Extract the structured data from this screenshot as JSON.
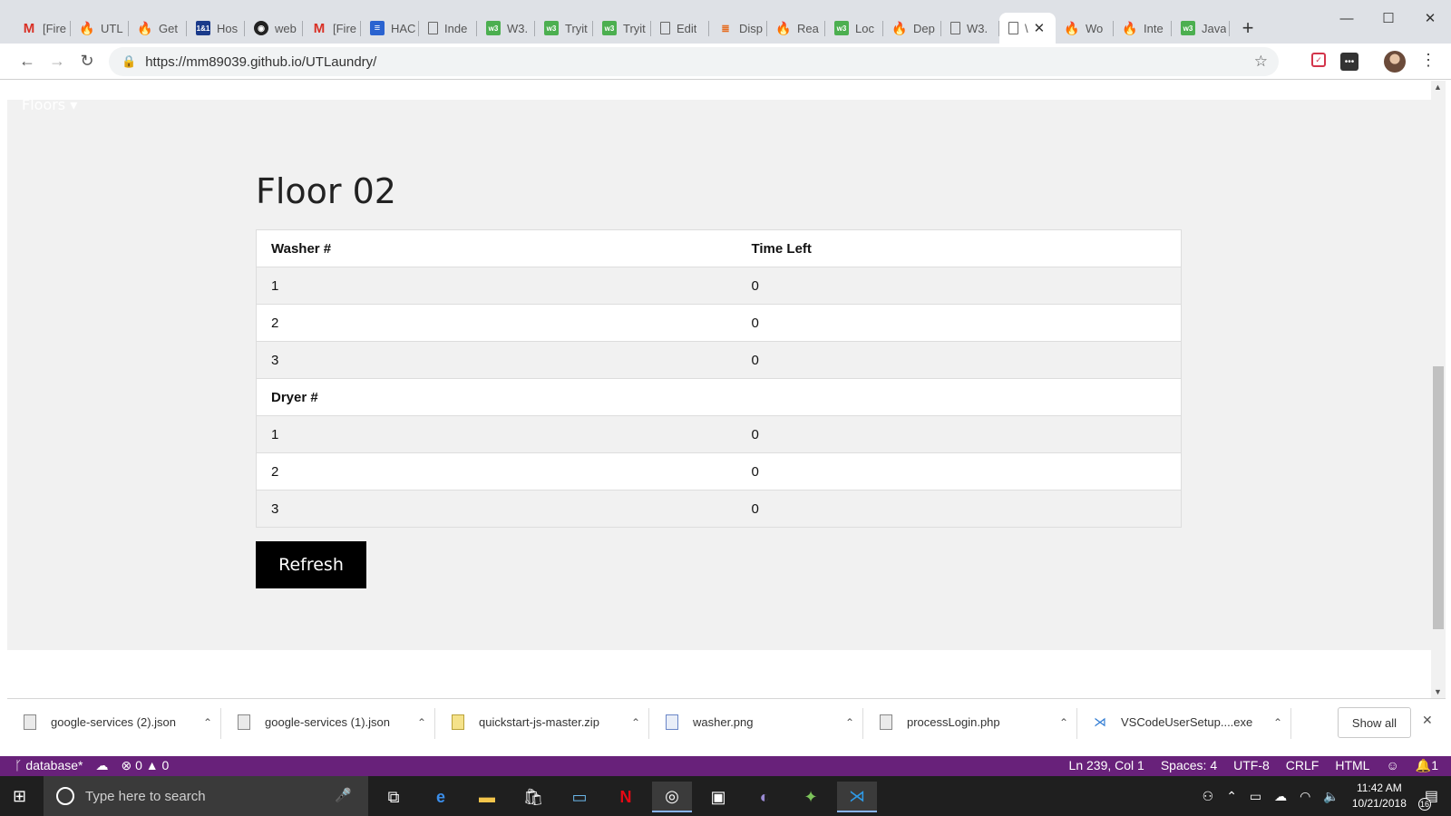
{
  "browser": {
    "tabs": [
      {
        "title": "[Fire",
        "icon": "gmail-icon",
        "glyph": "M",
        "cls": "ico-gmail"
      },
      {
        "title": "UTL",
        "icon": "firebase-icon",
        "glyph": "🔥",
        "cls": "ico-fire"
      },
      {
        "title": "Get",
        "icon": "firebase-icon",
        "glyph": "🔥",
        "cls": "ico-fire"
      },
      {
        "title": "Hos",
        "icon": "host-icon",
        "glyph": "1&1",
        "cls": "ico-hos"
      },
      {
        "title": "web",
        "icon": "github-icon",
        "glyph": "◉",
        "cls": "ico-gh"
      },
      {
        "title": "[Fire",
        "icon": "gmail-icon",
        "glyph": "M",
        "cls": "ico-gmail"
      },
      {
        "title": "HAC",
        "icon": "docs-icon",
        "glyph": "≡",
        "cls": "ico-hac"
      },
      {
        "title": "Inde",
        "icon": "page-icon",
        "glyph": "",
        "cls": "ico-doc"
      },
      {
        "title": "W3.",
        "icon": "w3schools-icon",
        "glyph": "w3",
        "cls": "ico-w3"
      },
      {
        "title": "Tryit",
        "icon": "w3schools-icon",
        "glyph": "w3",
        "cls": "ico-w3"
      },
      {
        "title": "Tryit",
        "icon": "w3schools-icon",
        "glyph": "w3",
        "cls": "ico-w3"
      },
      {
        "title": "Edit",
        "icon": "page-icon",
        "glyph": "",
        "cls": "ico-doc"
      },
      {
        "title": "Disp",
        "icon": "stackoverflow-icon",
        "glyph": "≣",
        "cls": "ico-disp"
      },
      {
        "title": "Rea",
        "icon": "firebase-icon",
        "glyph": "🔥",
        "cls": "ico-fire"
      },
      {
        "title": "Loc",
        "icon": "w3schools-icon",
        "glyph": "w3",
        "cls": "ico-w3"
      },
      {
        "title": "Dep",
        "icon": "firebase-icon",
        "glyph": "🔥",
        "cls": "ico-fire"
      },
      {
        "title": "W3.",
        "icon": "page-icon",
        "glyph": "",
        "cls": "ico-doc"
      },
      {
        "title": "\\",
        "icon": "page-icon",
        "glyph": "",
        "cls": "ico-doc",
        "active": true
      },
      {
        "title": "Wo",
        "icon": "firebase-icon",
        "glyph": "🔥",
        "cls": "ico-fire"
      },
      {
        "title": "Inte",
        "icon": "firebase-icon",
        "glyph": "🔥",
        "cls": "ico-fire"
      },
      {
        "title": "Java",
        "icon": "w3schools-icon",
        "glyph": "w3",
        "cls": "ico-w3"
      }
    ],
    "url": "https://mm89039.github.io/UTLaundry/"
  },
  "page": {
    "nav_floors": "Floors ▾",
    "title": "Floor 02",
    "washer_header": "Washer #",
    "time_header": "Time Left",
    "washers": [
      {
        "num": "1",
        "time": "0"
      },
      {
        "num": "2",
        "time": "0"
      },
      {
        "num": "3",
        "time": "0"
      }
    ],
    "dryer_header": "Dryer #",
    "dryers": [
      {
        "num": "1",
        "time": "0"
      },
      {
        "num": "2",
        "time": "0"
      },
      {
        "num": "3",
        "time": "0"
      }
    ],
    "refresh_label": "Refresh"
  },
  "downloads": {
    "items": [
      {
        "name": "google-services (2).json",
        "type": "json"
      },
      {
        "name": "google-services (1).json",
        "type": "json"
      },
      {
        "name": "quickstart-js-master.zip",
        "type": "zip"
      },
      {
        "name": "washer.png",
        "type": "png"
      },
      {
        "name": "processLogin.php",
        "type": "php"
      },
      {
        "name": "VSCodeUserSetup....exe",
        "type": "exe"
      }
    ],
    "show_all": "Show all"
  },
  "statusbar": {
    "branch": "database*",
    "errors": "⊗ 0 ▲ 0",
    "position": "Ln 239, Col 1",
    "spaces": "Spaces: 4",
    "encoding": "UTF-8",
    "eol": "CRLF",
    "language": "HTML",
    "notifications": "1"
  },
  "taskbar": {
    "search_placeholder": "Type here to search",
    "time": "11:42 AM",
    "date": "10/21/2018",
    "notification_count": "16"
  }
}
